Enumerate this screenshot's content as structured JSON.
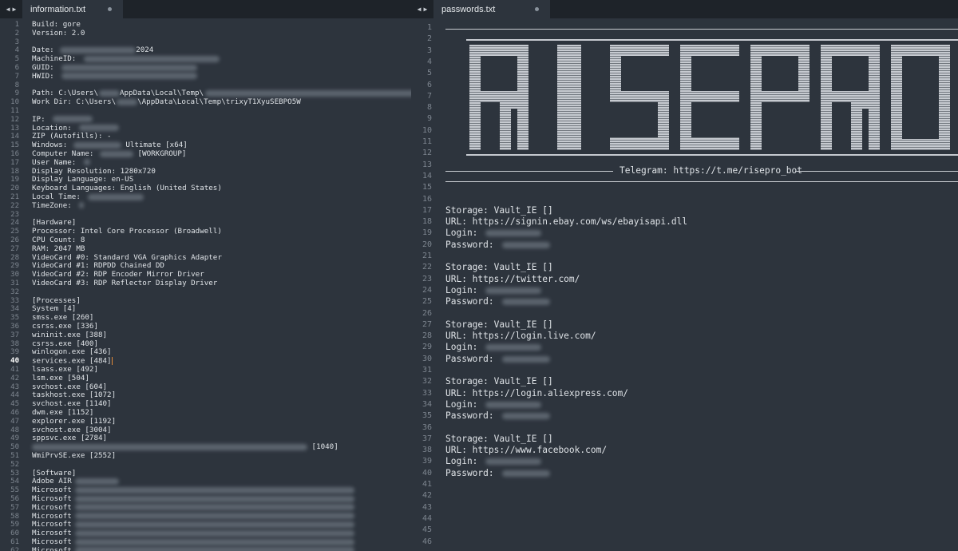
{
  "left_tab": {
    "title": "information.txt"
  },
  "right_tab": {
    "title": "passwords.txt"
  },
  "left_lines": [
    "Build: gore",
    "Version: 2.0",
    "",
    "Date: ",
    "MachineID: ",
    "GUID: ",
    "HWID: ",
    "",
    "Path: C:\\Users\\",
    "Work Dir: C:\\Users\\",
    "",
    "IP: ",
    "Location: ",
    "ZIP (Autofills): -",
    "Windows: ",
    "Computer Name: ",
    "User Name: ",
    "Display Resolution: 1280x720",
    "Display Language: en-US",
    "Keyboard Languages: English (United States)",
    "Local Time: ",
    "TimeZone: ",
    "",
    "[Hardware]",
    "Processor: Intel Core Processor (Broadwell)",
    "CPU Count: 8",
    "RAM: 2047 MB",
    "VideoCard #0: Standard VGA Graphics Adapter",
    "VideoCard #1: RDPDD Chained DD",
    "VideoCard #2: RDP Encoder Mirror Driver",
    "VideoCard #3: RDP Reflector Display Driver",
    "",
    "[Processes]",
    "System [4]",
    "smss.exe [260]",
    "csrss.exe [336]",
    "wininit.exe [388]",
    "csrss.exe [400]",
    "winlogon.exe [436]",
    "services.exe [484]",
    "lsass.exe [492]",
    "lsm.exe [504]",
    "svchost.exe [604]",
    "taskhost.exe [1072]",
    "svchost.exe [1140]",
    "dwm.exe [1152]",
    "explorer.exe [1192]",
    "svchost.exe [3004]",
    "sppsvc.exe [2784]",
    "",
    "WmiPrvSE.exe [2552]",
    "",
    "[Software]",
    "Adobe AIR",
    "Microsoft",
    "Microsoft",
    "Microsoft",
    "Microsoft",
    "Microsoft",
    "Microsoft",
    "Microsoft",
    "Microsoft"
  ],
  "left_inline": {
    "date_year": "2024",
    "path_suffix": "AppData\\Local\\Temp\\",
    "workdir_suffix": "\\AppData\\Local\\Temp\\trixyT1XyuSEBPO5W",
    "windows_suffix": "Ultimate [x64]",
    "computer_suffix": "[WORKGROUP]",
    "line50_suffix": "[1040]"
  },
  "right": {
    "telegram": "Telegram: https://t.me/risepro_bot",
    "logo_text": "RISEPRO",
    "entries": [
      {
        "storage": "Storage: Vault_IE []",
        "url": "URL: https://signin.ebay.com/ws/ebayisapi.dll",
        "login": "Login:",
        "password": "Password:"
      },
      {
        "storage": "Storage: Vault_IE []",
        "url": "URL: https://twitter.com/",
        "login": "Login:",
        "password": "Password:"
      },
      {
        "storage": "Storage: Vault_IE []",
        "url": "URL: https://login.live.com/",
        "login": "Login:",
        "password": "Password:"
      },
      {
        "storage": "Storage: Vault_IE []",
        "url": "URL: https://login.aliexpress.com/",
        "login": "Login:",
        "password": "Password:"
      },
      {
        "storage": "Storage: Vault_IE []",
        "url": "URL: https://www.facebook.com/",
        "login": "Login:",
        "password": "Password:"
      }
    ]
  },
  "colors": {
    "background": "#2d343d",
    "tabbar": "#1e2329",
    "text": "#dfe3e7",
    "gutter": "#7d858f",
    "caret": "#e08a3a"
  }
}
